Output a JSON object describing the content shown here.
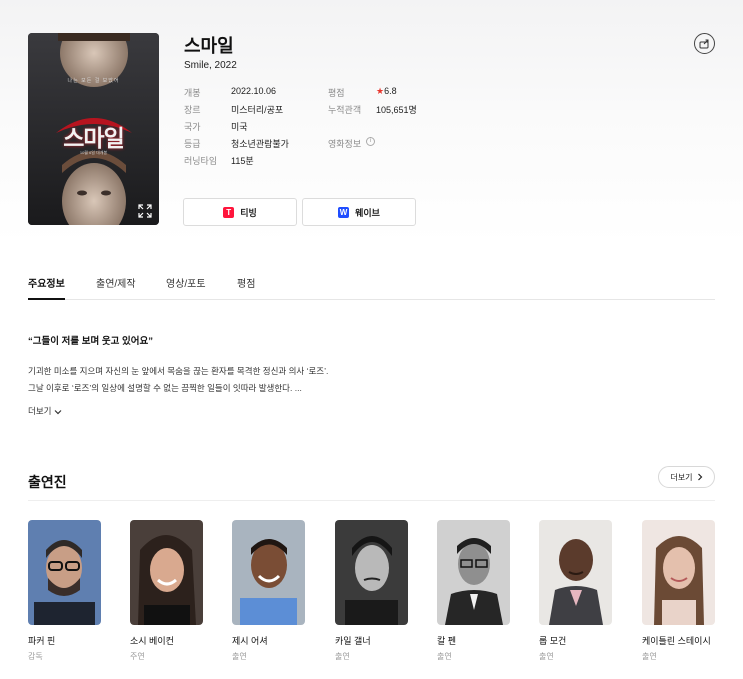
{
  "movie": {
    "title": "스마일",
    "subtitle": "Smile, 2022",
    "poster": {
      "tagline": "나는 모든 걸 보았어",
      "title_text": "스마일",
      "release_text": "10월 6일 대개봉"
    },
    "meta": {
      "release_label": "개봉",
      "release_value": "2022.10.06",
      "genre_label": "장르",
      "genre_value": "미스터리/공포",
      "country_label": "국가",
      "country_value": "미국",
      "grade_label": "등급",
      "grade_value": "청소년관람불가",
      "runtime_label": "러닝타임",
      "runtime_value": "115분",
      "rating_label": "평점",
      "rating_star": "★",
      "rating_value": "6.8",
      "audience_label": "누적관객",
      "audience_value": "105,651명",
      "movie_info_label": "영화정보",
      "info_icon_text": "i"
    },
    "ott": [
      {
        "label": "티빙",
        "logo_text": "T",
        "color": "#ff153c",
        "icon": "tving-icon"
      },
      {
        "label": "웨이브",
        "logo_text": "W",
        "color": "#1f4dff",
        "icon": "wavve-icon"
      }
    ]
  },
  "tabs": [
    {
      "label": "주요정보",
      "active": true
    },
    {
      "label": "출연/제작",
      "active": false
    },
    {
      "label": "영상/포토",
      "active": false
    },
    {
      "label": "평점",
      "active": false
    }
  ],
  "summary": {
    "quote": "“그들이 저를 보며 웃고 있어요”",
    "lines": [
      "기괴한 미소를 지으며 자신의 눈 앞에서 목숨을 끊는 환자를 목격한 정신과 의사 ‘로즈’.",
      "그날 이후로 ‘로즈’의 일상에 설명할 수 없는 끔찍한 일들이 잇따라 발생한다. ..."
    ],
    "more_label": "더보기"
  },
  "cast": {
    "title": "출연진",
    "more_label": "더보기",
    "members": [
      {
        "name": "파커 핀",
        "role": "감독"
      },
      {
        "name": "소시 베이컨",
        "role": "주연"
      },
      {
        "name": "제시 어셔",
        "role": "출연"
      },
      {
        "name": "카일 갤너",
        "role": "출연"
      },
      {
        "name": "칼 펜",
        "role": "출연"
      },
      {
        "name": "롭 모건",
        "role": "출연"
      },
      {
        "name": "케이틀린 스테이시",
        "role": "출연"
      }
    ]
  },
  "colors": {
    "rating_star": "#e8362d",
    "tving": "#ff153c",
    "wavve": "#1f4dff"
  }
}
